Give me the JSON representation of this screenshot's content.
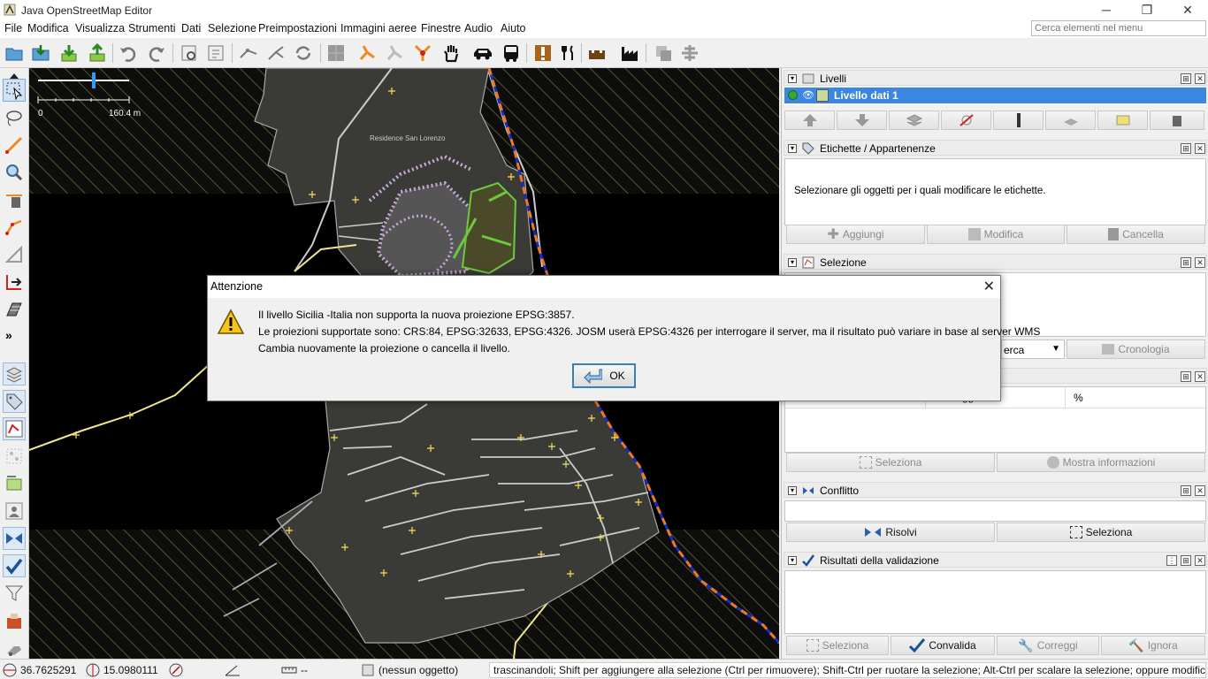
{
  "window": {
    "title": "Java OpenStreetMap Editor",
    "minimize_glyph": "─",
    "restore_glyph": "❐",
    "close_glyph": "✕"
  },
  "menubar": {
    "items": [
      "File",
      "Modifica",
      "Visualizza",
      "Strumenti",
      "Dati",
      "Selezione",
      "Preimpostazioni",
      "Immagini aeree",
      "Finestre",
      "Audio",
      "Aiuto"
    ],
    "search_placeholder": "Cerca elementi nel menu"
  },
  "map": {
    "scale_zero": "0",
    "scale_value": "160.4 m",
    "place_label": "Residence San Lorenzo"
  },
  "panels": {
    "layers": {
      "title": "Livelli",
      "layer_name": "Livello dati 1"
    },
    "tags": {
      "title": "Etichette / Appartenenze",
      "message": "Selezionare gli oggetti per i quali modificare le etichette.",
      "add": "Aggiungi",
      "edit": "Modifica",
      "delete": "Cancella"
    },
    "selection": {
      "title": "Selezione",
      "search_partial": "erca",
      "history": "Cronologia"
    },
    "filter": {
      "cell_partial": "gg",
      "percent": "%",
      "select": "Seleziona",
      "show_info": "Mostra informazioni"
    },
    "conflict": {
      "title": "Conflitto",
      "resolve": "Risolvi",
      "select": "Seleziona"
    },
    "validation": {
      "title": "Risultati della validazione",
      "select": "Seleziona",
      "validate": "Convalida",
      "fix": "Correggi",
      "ignore": "Ignora"
    }
  },
  "statusbar": {
    "lat": "36.7625291",
    "lon": "15.0980111",
    "angle": "",
    "distance": "--",
    "object": "(nessun oggetto)",
    "help": "trascinandoli; Shift per aggiungere alla selezione (Ctrl per rimuovere); Shift-Ctrl per ruotare la selezione; Alt-Ctrl per scalare la selezione; oppure modificare la selezione"
  },
  "dialog": {
    "title": "Attenzione",
    "line1": "Il livello Sicilia -Italia non supporta la nuova proiezione EPSG:3857.",
    "line2": "Le proiezioni supportate sono: CRS:84, EPSG:32633, EPSG:4326. JOSM userà EPSG:4326 per interrogare il server, ma il risultato può variare in base al server WMS",
    "line3": "Cambia nuovamente la proiezione o cancella il livello.",
    "ok": "OK"
  },
  "colors": {
    "accent": "#3399ff",
    "selected_layer": "#3a86e0",
    "coast_orange": "#f07820",
    "coast_blue": "#1030c8",
    "road_yellow": "#f0e68c"
  }
}
